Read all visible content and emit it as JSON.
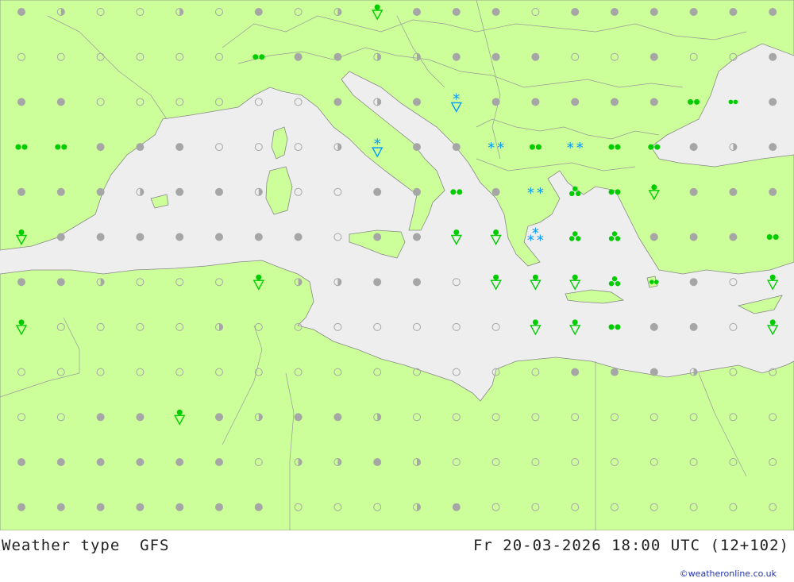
{
  "title": "Weather type",
  "model": "GFS",
  "valid_time": "Fr 20-03-2026 18:00 UTC (12+102)",
  "credit": "©weatheronline.co.uk",
  "colors": {
    "land": "#ccff99",
    "sea": "#eeeeee",
    "border": "#999999",
    "cloud_symbol": "#a6a6a6",
    "rain_symbol": "#00cc00",
    "snow_symbol": "#0099ff"
  },
  "symbols": [
    {
      "lon": 0,
      "lat": 0,
      "type": "overcast"
    },
    {
      "lon": 1,
      "lat": 0,
      "type": "partly"
    },
    {
      "lon": 2,
      "lat": 0,
      "type": "clear"
    },
    {
      "lon": 3,
      "lat": 0,
      "type": "clear"
    },
    {
      "lon": 4,
      "lat": 0,
      "type": "partly"
    },
    {
      "lon": 5,
      "lat": 0,
      "type": "clear"
    },
    {
      "lon": 6,
      "lat": 0,
      "type": "overcast"
    },
    {
      "lon": 7,
      "lat": 0,
      "type": "clear"
    },
    {
      "lon": 8,
      "lat": 0,
      "type": "partly"
    },
    {
      "lon": 9,
      "lat": 0,
      "type": "shower"
    },
    {
      "lon": 10,
      "lat": 0,
      "type": "overcast"
    },
    {
      "lon": 11,
      "lat": 0,
      "type": "overcast"
    },
    {
      "lon": 12,
      "lat": 0,
      "type": "overcast"
    },
    {
      "lon": 13,
      "lat": 0,
      "type": "clear"
    },
    {
      "lon": 14,
      "lat": 0,
      "type": "overcast"
    },
    {
      "lon": 15,
      "lat": 0,
      "type": "overcast"
    },
    {
      "lon": 16,
      "lat": 0,
      "type": "overcast"
    },
    {
      "lon": 17,
      "lat": 0,
      "type": "overcast"
    },
    {
      "lon": 18,
      "lat": 0,
      "type": "overcast"
    },
    {
      "lon": 19,
      "lat": 0,
      "type": "overcast"
    },
    {
      "lon": 0,
      "lat": 1,
      "type": "clear"
    },
    {
      "lon": 1,
      "lat": 1,
      "type": "clear"
    },
    {
      "lon": 2,
      "lat": 1,
      "type": "clear"
    },
    {
      "lon": 3,
      "lat": 1,
      "type": "clear"
    },
    {
      "lon": 4,
      "lat": 1,
      "type": "clear"
    },
    {
      "lon": 5,
      "lat": 1,
      "type": "clear"
    },
    {
      "lon": 6,
      "lat": 1,
      "type": "rain"
    },
    {
      "lon": 7,
      "lat": 1,
      "type": "overcast"
    },
    {
      "lon": 8,
      "lat": 1,
      "type": "overcast"
    },
    {
      "lon": 9,
      "lat": 1,
      "type": "partly"
    },
    {
      "lon": 10,
      "lat": 1,
      "type": "partly"
    },
    {
      "lon": 11,
      "lat": 1,
      "type": "overcast"
    },
    {
      "lon": 12,
      "lat": 1,
      "type": "overcast"
    },
    {
      "lon": 13,
      "lat": 1,
      "type": "overcast"
    },
    {
      "lon": 14,
      "lat": 1,
      "type": "clear"
    },
    {
      "lon": 15,
      "lat": 1,
      "type": "clear"
    },
    {
      "lon": 16,
      "lat": 1,
      "type": "overcast"
    },
    {
      "lon": 17,
      "lat": 1,
      "type": "clear"
    },
    {
      "lon": 18,
      "lat": 1,
      "type": "clear"
    },
    {
      "lon": 19,
      "lat": 1,
      "type": "overcast"
    },
    {
      "lon": 0,
      "lat": 2,
      "type": "overcast"
    },
    {
      "lon": 1,
      "lat": 2,
      "type": "overcast"
    },
    {
      "lon": 2,
      "lat": 2,
      "type": "clear"
    },
    {
      "lon": 3,
      "lat": 2,
      "type": "clear"
    },
    {
      "lon": 4,
      "lat": 2,
      "type": "clear"
    },
    {
      "lon": 5,
      "lat": 2,
      "type": "clear"
    },
    {
      "lon": 6,
      "lat": 2,
      "type": "clear"
    },
    {
      "lon": 7,
      "lat": 2,
      "type": "clear"
    },
    {
      "lon": 8,
      "lat": 2,
      "type": "overcast"
    },
    {
      "lon": 9,
      "lat": 2,
      "type": "partly"
    },
    {
      "lon": 10,
      "lat": 2,
      "type": "overcast"
    },
    {
      "lon": 11,
      "lat": 2,
      "type": "snow-shower"
    },
    {
      "lon": 12,
      "lat": 2,
      "type": "overcast"
    },
    {
      "lon": 13,
      "lat": 2,
      "type": "overcast"
    },
    {
      "lon": 14,
      "lat": 2,
      "type": "overcast"
    },
    {
      "lon": 15,
      "lat": 2,
      "type": "overcast"
    },
    {
      "lon": 16,
      "lat": 2,
      "type": "overcast"
    },
    {
      "lon": 17,
      "lat": 2,
      "type": "rain"
    },
    {
      "lon": 18,
      "lat": 2,
      "type": "rain-light"
    },
    {
      "lon": 19,
      "lat": 2,
      "type": "overcast"
    },
    {
      "lon": 0,
      "lat": 3,
      "type": "rain"
    },
    {
      "lon": 1,
      "lat": 3,
      "type": "rain"
    },
    {
      "lon": 2,
      "lat": 3,
      "type": "overcast"
    },
    {
      "lon": 3,
      "lat": 3,
      "type": "overcast"
    },
    {
      "lon": 4,
      "lat": 3,
      "type": "overcast"
    },
    {
      "lon": 5,
      "lat": 3,
      "type": "clear"
    },
    {
      "lon": 6,
      "lat": 3,
      "type": "clear"
    },
    {
      "lon": 7,
      "lat": 3,
      "type": "clear"
    },
    {
      "lon": 8,
      "lat": 3,
      "type": "partly"
    },
    {
      "lon": 9,
      "lat": 3,
      "type": "snow-shower"
    },
    {
      "lon": 10,
      "lat": 3,
      "type": "overcast"
    },
    {
      "lon": 11,
      "lat": 3,
      "type": "overcast"
    },
    {
      "lon": 12,
      "lat": 3,
      "type": "snow"
    },
    {
      "lon": 13,
      "lat": 3,
      "type": "rain"
    },
    {
      "lon": 14,
      "lat": 3,
      "type": "snow"
    },
    {
      "lon": 15,
      "lat": 3,
      "type": "rain"
    },
    {
      "lon": 16,
      "lat": 3,
      "type": "rain"
    },
    {
      "lon": 17,
      "lat": 3,
      "type": "overcast"
    },
    {
      "lon": 18,
      "lat": 3,
      "type": "partly"
    },
    {
      "lon": 19,
      "lat": 3,
      "type": "overcast"
    },
    {
      "lon": 0,
      "lat": 4,
      "type": "overcast"
    },
    {
      "lon": 1,
      "lat": 4,
      "type": "overcast"
    },
    {
      "lon": 2,
      "lat": 4,
      "type": "overcast"
    },
    {
      "lon": 3,
      "lat": 4,
      "type": "partly"
    },
    {
      "lon": 4,
      "lat": 4,
      "type": "overcast"
    },
    {
      "lon": 5,
      "lat": 4,
      "type": "overcast"
    },
    {
      "lon": 6,
      "lat": 4,
      "type": "partly"
    },
    {
      "lon": 7,
      "lat": 4,
      "type": "clear"
    },
    {
      "lon": 8,
      "lat": 4,
      "type": "clear"
    },
    {
      "lon": 9,
      "lat": 4,
      "type": "overcast"
    },
    {
      "lon": 10,
      "lat": 4,
      "type": "overcast"
    },
    {
      "lon": 11,
      "lat": 4,
      "type": "rain"
    },
    {
      "lon": 12,
      "lat": 4,
      "type": "overcast"
    },
    {
      "lon": 13,
      "lat": 4,
      "type": "snow"
    },
    {
      "lon": 14,
      "lat": 4,
      "type": "rain-heavy"
    },
    {
      "lon": 15,
      "lat": 4,
      "type": "rain"
    },
    {
      "lon": 16,
      "lat": 4,
      "type": "shower"
    },
    {
      "lon": 17,
      "lat": 4,
      "type": "overcast"
    },
    {
      "lon": 18,
      "lat": 4,
      "type": "overcast"
    },
    {
      "lon": 19,
      "lat": 4,
      "type": "overcast"
    },
    {
      "lon": 0,
      "lat": 5,
      "type": "shower"
    },
    {
      "lon": 1,
      "lat": 5,
      "type": "overcast"
    },
    {
      "lon": 2,
      "lat": 5,
      "type": "overcast"
    },
    {
      "lon": 3,
      "lat": 5,
      "type": "overcast"
    },
    {
      "lon": 4,
      "lat": 5,
      "type": "overcast"
    },
    {
      "lon": 5,
      "lat": 5,
      "type": "overcast"
    },
    {
      "lon": 6,
      "lat": 5,
      "type": "overcast"
    },
    {
      "lon": 7,
      "lat": 5,
      "type": "overcast"
    },
    {
      "lon": 8,
      "lat": 5,
      "type": "clear"
    },
    {
      "lon": 9,
      "lat": 5,
      "type": "overcast"
    },
    {
      "lon": 10,
      "lat": 5,
      "type": "overcast"
    },
    {
      "lon": 11,
      "lat": 5,
      "type": "shower"
    },
    {
      "lon": 12,
      "lat": 5,
      "type": "shower"
    },
    {
      "lon": 13,
      "lat": 5,
      "type": "snow-heavy"
    },
    {
      "lon": 14,
      "lat": 5,
      "type": "rain-heavy"
    },
    {
      "lon": 15,
      "lat": 5,
      "type": "rain-heavy"
    },
    {
      "lon": 16,
      "lat": 5,
      "type": "overcast"
    },
    {
      "lon": 17,
      "lat": 5,
      "type": "overcast"
    },
    {
      "lon": 18,
      "lat": 5,
      "type": "overcast"
    },
    {
      "lon": 19,
      "lat": 5,
      "type": "rain"
    },
    {
      "lon": 0,
      "lat": 6,
      "type": "overcast"
    },
    {
      "lon": 1,
      "lat": 6,
      "type": "overcast"
    },
    {
      "lon": 2,
      "lat": 6,
      "type": "partly"
    },
    {
      "lon": 3,
      "lat": 6,
      "type": "clear"
    },
    {
      "lon": 4,
      "lat": 6,
      "type": "clear"
    },
    {
      "lon": 5,
      "lat": 6,
      "type": "clear"
    },
    {
      "lon": 6,
      "lat": 6,
      "type": "shower"
    },
    {
      "lon": 7,
      "lat": 6,
      "type": "partly"
    },
    {
      "lon": 8,
      "lat": 6,
      "type": "partly"
    },
    {
      "lon": 9,
      "lat": 6,
      "type": "overcast"
    },
    {
      "lon": 10,
      "lat": 6,
      "type": "overcast"
    },
    {
      "lon": 11,
      "lat": 6,
      "type": "clear"
    },
    {
      "lon": 12,
      "lat": 6,
      "type": "shower"
    },
    {
      "lon": 13,
      "lat": 6,
      "type": "shower"
    },
    {
      "lon": 14,
      "lat": 6,
      "type": "shower"
    },
    {
      "lon": 15,
      "lat": 6,
      "type": "rain-heavy"
    },
    {
      "lon": 16,
      "lat": 6,
      "type": "rain-light"
    },
    {
      "lon": 17,
      "lat": 6,
      "type": "overcast"
    },
    {
      "lon": 18,
      "lat": 6,
      "type": "clear"
    },
    {
      "lon": 19,
      "lat": 6,
      "type": "shower"
    },
    {
      "lon": 0,
      "lat": 7,
      "type": "shower"
    },
    {
      "lon": 1,
      "lat": 7,
      "type": "clear"
    },
    {
      "lon": 2,
      "lat": 7,
      "type": "clear"
    },
    {
      "lon": 3,
      "lat": 7,
      "type": "clear"
    },
    {
      "lon": 4,
      "lat": 7,
      "type": "clear"
    },
    {
      "lon": 5,
      "lat": 7,
      "type": "partly"
    },
    {
      "lon": 6,
      "lat": 7,
      "type": "clear"
    },
    {
      "lon": 7,
      "lat": 7,
      "type": "clear"
    },
    {
      "lon": 8,
      "lat": 7,
      "type": "clear"
    },
    {
      "lon": 9,
      "lat": 7,
      "type": "clear"
    },
    {
      "lon": 10,
      "lat": 7,
      "type": "clear"
    },
    {
      "lon": 11,
      "lat": 7,
      "type": "clear"
    },
    {
      "lon": 12,
      "lat": 7,
      "type": "clear"
    },
    {
      "lon": 13,
      "lat": 7,
      "type": "shower"
    },
    {
      "lon": 14,
      "lat": 7,
      "type": "shower"
    },
    {
      "lon": 15,
      "lat": 7,
      "type": "rain"
    },
    {
      "lon": 16,
      "lat": 7,
      "type": "overcast"
    },
    {
      "lon": 17,
      "lat": 7,
      "type": "overcast"
    },
    {
      "lon": 18,
      "lat": 7,
      "type": "clear"
    },
    {
      "lon": 19,
      "lat": 7,
      "type": "shower"
    },
    {
      "lon": 0,
      "lat": 8,
      "type": "clear"
    },
    {
      "lon": 1,
      "lat": 8,
      "type": "clear"
    },
    {
      "lon": 2,
      "lat": 8,
      "type": "clear"
    },
    {
      "lon": 3,
      "lat": 8,
      "type": "clear"
    },
    {
      "lon": 4,
      "lat": 8,
      "type": "clear"
    },
    {
      "lon": 5,
      "lat": 8,
      "type": "clear"
    },
    {
      "lon": 6,
      "lat": 8,
      "type": "clear"
    },
    {
      "lon": 7,
      "lat": 8,
      "type": "clear"
    },
    {
      "lon": 8,
      "lat": 8,
      "type": "clear"
    },
    {
      "lon": 9,
      "lat": 8,
      "type": "clear"
    },
    {
      "lon": 10,
      "lat": 8,
      "type": "clear"
    },
    {
      "lon": 11,
      "lat": 8,
      "type": "clear"
    },
    {
      "lon": 12,
      "lat": 8,
      "type": "clear"
    },
    {
      "lon": 13,
      "lat": 8,
      "type": "clear"
    },
    {
      "lon": 14,
      "lat": 8,
      "type": "overcast"
    },
    {
      "lon": 15,
      "lat": 8,
      "type": "overcast"
    },
    {
      "lon": 16,
      "lat": 8,
      "type": "overcast"
    },
    {
      "lon": 17,
      "lat": 8,
      "type": "partly"
    },
    {
      "lon": 18,
      "lat": 8,
      "type": "clear"
    },
    {
      "lon": 19,
      "lat": 8,
      "type": "clear"
    },
    {
      "lon": 0,
      "lat": 9,
      "type": "clear"
    },
    {
      "lon": 1,
      "lat": 9,
      "type": "clear"
    },
    {
      "lon": 2,
      "lat": 9,
      "type": "overcast"
    },
    {
      "lon": 3,
      "lat": 9,
      "type": "overcast"
    },
    {
      "lon": 4,
      "lat": 9,
      "type": "shower"
    },
    {
      "lon": 5,
      "lat": 9,
      "type": "overcast"
    },
    {
      "lon": 6,
      "lat": 9,
      "type": "partly"
    },
    {
      "lon": 7,
      "lat": 9,
      "type": "overcast"
    },
    {
      "lon": 8,
      "lat": 9,
      "type": "overcast"
    },
    {
      "lon": 9,
      "lat": 9,
      "type": "partly"
    },
    {
      "lon": 10,
      "lat": 9,
      "type": "clear"
    },
    {
      "lon": 11,
      "lat": 9,
      "type": "clear"
    },
    {
      "lon": 12,
      "lat": 9,
      "type": "clear"
    },
    {
      "lon": 13,
      "lat": 9,
      "type": "clear"
    },
    {
      "lon": 14,
      "lat": 9,
      "type": "clear"
    },
    {
      "lon": 15,
      "lat": 9,
      "type": "clear"
    },
    {
      "lon": 16,
      "lat": 9,
      "type": "clear"
    },
    {
      "lon": 17,
      "lat": 9,
      "type": "clear"
    },
    {
      "lon": 18,
      "lat": 9,
      "type": "clear"
    },
    {
      "lon": 19,
      "lat": 9,
      "type": "clear"
    },
    {
      "lon": 0,
      "lat": 10,
      "type": "overcast"
    },
    {
      "lon": 1,
      "lat": 10,
      "type": "overcast"
    },
    {
      "lon": 2,
      "lat": 10,
      "type": "overcast"
    },
    {
      "lon": 3,
      "lat": 10,
      "type": "overcast"
    },
    {
      "lon": 4,
      "lat": 10,
      "type": "overcast"
    },
    {
      "lon": 5,
      "lat": 10,
      "type": "overcast"
    },
    {
      "lon": 6,
      "lat": 10,
      "type": "clear"
    },
    {
      "lon": 7,
      "lat": 10,
      "type": "partly"
    },
    {
      "lon": 8,
      "lat": 10,
      "type": "partly"
    },
    {
      "lon": 9,
      "lat": 10,
      "type": "overcast"
    },
    {
      "lon": 10,
      "lat": 10,
      "type": "partly"
    },
    {
      "lon": 11,
      "lat": 10,
      "type": "clear"
    },
    {
      "lon": 12,
      "lat": 10,
      "type": "clear"
    },
    {
      "lon": 13,
      "lat": 10,
      "type": "clear"
    },
    {
      "lon": 14,
      "lat": 10,
      "type": "clear"
    },
    {
      "lon": 15,
      "lat": 10,
      "type": "clear"
    },
    {
      "lon": 16,
      "lat": 10,
      "type": "clear"
    },
    {
      "lon": 17,
      "lat": 10,
      "type": "clear"
    },
    {
      "lon": 18,
      "lat": 10,
      "type": "clear"
    },
    {
      "lon": 19,
      "lat": 10,
      "type": "clear"
    },
    {
      "lon": 0,
      "lat": 11,
      "type": "overcast"
    },
    {
      "lon": 1,
      "lat": 11,
      "type": "overcast"
    },
    {
      "lon": 2,
      "lat": 11,
      "type": "overcast"
    },
    {
      "lon": 3,
      "lat": 11,
      "type": "overcast"
    },
    {
      "lon": 4,
      "lat": 11,
      "type": "overcast"
    },
    {
      "lon": 5,
      "lat": 11,
      "type": "overcast"
    },
    {
      "lon": 6,
      "lat": 11,
      "type": "overcast"
    },
    {
      "lon": 7,
      "lat": 11,
      "type": "clear"
    },
    {
      "lon": 8,
      "lat": 11,
      "type": "clear"
    },
    {
      "lon": 9,
      "lat": 11,
      "type": "clear"
    },
    {
      "lon": 10,
      "lat": 11,
      "type": "partly"
    },
    {
      "lon": 11,
      "lat": 11,
      "type": "overcast"
    },
    {
      "lon": 12,
      "lat": 11,
      "type": "clear"
    },
    {
      "lon": 13,
      "lat": 11,
      "type": "clear"
    },
    {
      "lon": 14,
      "lat": 11,
      "type": "clear"
    },
    {
      "lon": 15,
      "lat": 11,
      "type": "clear"
    },
    {
      "lon": 16,
      "lat": 11,
      "type": "clear"
    },
    {
      "lon": 17,
      "lat": 11,
      "type": "clear"
    },
    {
      "lon": 18,
      "lat": 11,
      "type": "clear"
    },
    {
      "lon": 19,
      "lat": 11,
      "type": "clear"
    }
  ]
}
